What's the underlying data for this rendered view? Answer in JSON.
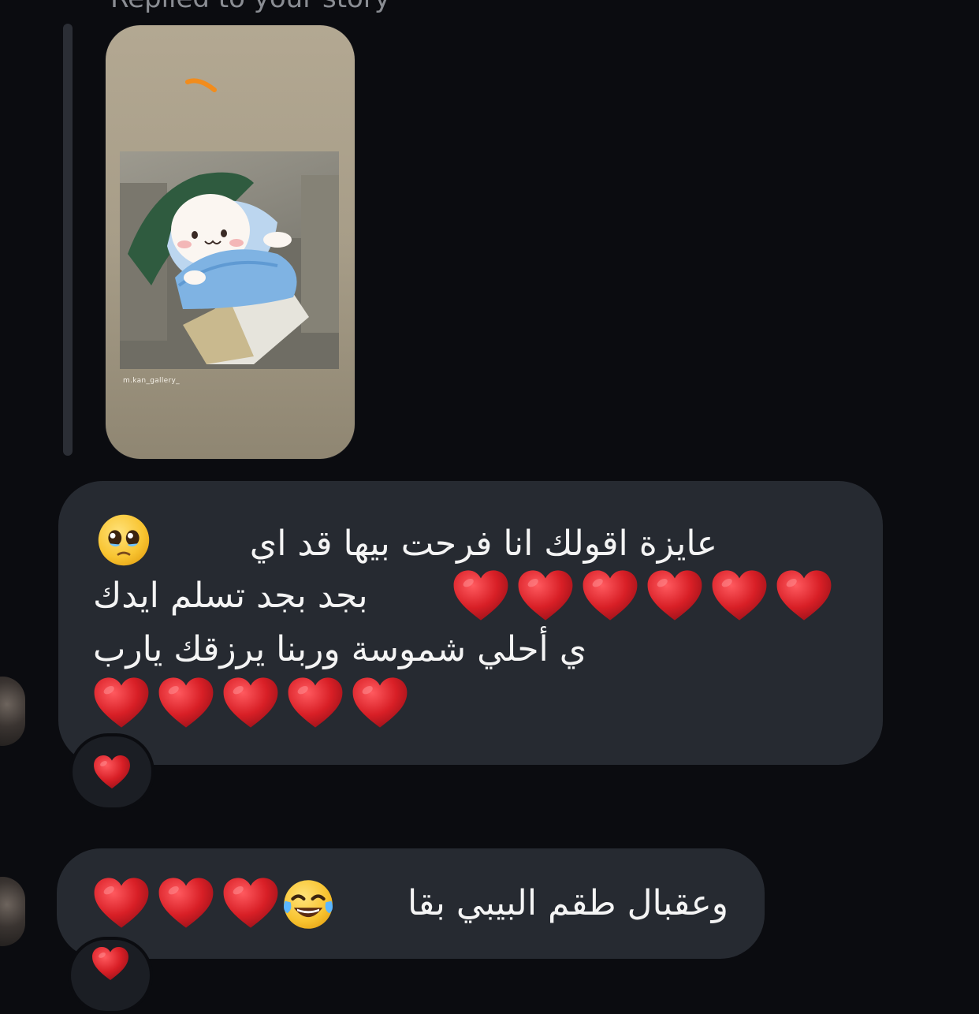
{
  "story_reply": {
    "caption": "Replied to your story",
    "watermark": "m.kan_gallery_"
  },
  "messages": [
    {
      "line1": "عايزة اقولك انا فرحت بيها قد اي",
      "line1_emoji": "pleading-face-icon",
      "line2_text": "بجد بجد تسلم ايدك",
      "line2_hearts": 6,
      "line3": "ي أحلي شموسة وربنا يرزقك يارب",
      "line4_hearts": 5,
      "reaction": "red-heart-icon"
    },
    {
      "text": "وعقبال طقم البيبي بقا",
      "emoji": "tears-of-joy-icon",
      "hearts": 3,
      "reaction": "red-heart-icon"
    }
  ],
  "colors": {
    "background": "#0b0c10",
    "bubble": "#262a31",
    "heart": "#d81f26"
  }
}
